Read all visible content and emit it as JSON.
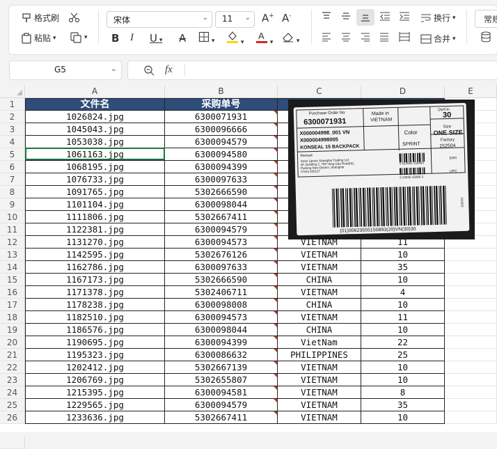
{
  "ribbon": {
    "format_painter": "格式刷",
    "paste": "粘贴",
    "font_name": "宋体",
    "font_size": "11",
    "wrap_text": "换行",
    "merge": "合并",
    "number_format": "常规"
  },
  "name_box": "G5",
  "formula_icon": "fx",
  "columns": [
    "A",
    "B",
    "C",
    "D",
    "E"
  ],
  "headers": {
    "a": "文件名",
    "b": "采购单号"
  },
  "rows": [
    {
      "n": "1"
    },
    {
      "n": "2",
      "a": "1026824.jpg",
      "b": "6300071931",
      "c": "",
      "d": ""
    },
    {
      "n": "3",
      "a": "1045043.jpg",
      "b": "6300096666",
      "c": "",
      "d": ""
    },
    {
      "n": "4",
      "a": "1053038.jpg",
      "b": "6300094579",
      "c": "",
      "d": ""
    },
    {
      "n": "5",
      "a": "1061163.jpg",
      "b": "6300094580",
      "c": "",
      "d": ""
    },
    {
      "n": "6",
      "a": "1068195.jpg",
      "b": "6300094399",
      "c": "",
      "d": ""
    },
    {
      "n": "7",
      "a": "1076733.jpg",
      "b": "6300097633",
      "c": "",
      "d": ""
    },
    {
      "n": "8",
      "a": "1091765.jpg",
      "b": "5302666590",
      "c": "",
      "d": ""
    },
    {
      "n": "9",
      "a": "1101104.jpg",
      "b": "6300098044",
      "c": "",
      "d": ""
    },
    {
      "n": "10",
      "a": "1111806.jpg",
      "b": "5302667411",
      "c": "",
      "d": ""
    },
    {
      "n": "11",
      "a": "1122381.jpg",
      "b": "6300094579",
      "c": "",
      "d": ""
    },
    {
      "n": "12",
      "a": "1131270.jpg",
      "b": "6300094573",
      "c": "VIETNAM",
      "d": "11"
    },
    {
      "n": "13",
      "a": "1142595.jpg",
      "b": "5302676126",
      "c": "VIETNAM",
      "d": "10"
    },
    {
      "n": "14",
      "a": "1162786.jpg",
      "b": "6300097633",
      "c": "VIETNAM",
      "d": "35"
    },
    {
      "n": "15",
      "a": "1167173.jpg",
      "b": "5302666590",
      "c": "CHINA",
      "d": "10"
    },
    {
      "n": "16",
      "a": "1171378.jpg",
      "b": "5302406711",
      "c": "VIETNAM",
      "d": "4"
    },
    {
      "n": "17",
      "a": "1178238.jpg",
      "b": "6300098008",
      "c": "CHINA",
      "d": "10"
    },
    {
      "n": "18",
      "a": "1182510.jpg",
      "b": "6300094573",
      "c": "VIETNAM",
      "d": "11"
    },
    {
      "n": "19",
      "a": "1186576.jpg",
      "b": "6300098044",
      "c": "CHINA",
      "d": "10"
    },
    {
      "n": "20",
      "a": "1190695.jpg",
      "b": "6300094399",
      "c": "VietNam",
      "d": "22"
    },
    {
      "n": "21",
      "a": "1195323.jpg",
      "b": "6300086632",
      "c": "PHILIPPINES",
      "d": "25"
    },
    {
      "n": "22",
      "a": "1202412.jpg",
      "b": "5302667139",
      "c": "VIETNAM",
      "d": "10"
    },
    {
      "n": "23",
      "a": "1206769.jpg",
      "b": "5302655807",
      "c": "VIETNAM",
      "d": "10"
    },
    {
      "n": "24",
      "a": "1215395.jpg",
      "b": "6300094581",
      "c": "VIETNAM",
      "d": "8"
    },
    {
      "n": "25",
      "a": "1229565.jpg",
      "b": "6300094579",
      "c": "VIETNAM",
      "d": "35"
    },
    {
      "n": "26",
      "a": "1233636.jpg",
      "b": "5302667411",
      "c": "VIETNAM",
      "d": "10"
    }
  ],
  "label": {
    "po_title": "Purchase Order No",
    "po_number": "6300071931",
    "made_in_title": "Made in",
    "made_in": "VIETNAM",
    "qty_title": "Qty/Ctn",
    "qty": "30",
    "size_title": "Size",
    "size": "ONE SIZE",
    "article_line": "X000004998_001    VN",
    "article_code": "X000004998005",
    "product": "KONSEAL 15 BACKPACK",
    "color_title": "Color",
    "color": "SPRINT",
    "factory_title": "Factory",
    "factory": "152504",
    "remark": "Remark",
    "address1": "Amer Sports Shanghai Trading Ltd.",
    "address2": "3F, Building 2, 799 Yang Gao Road(S),",
    "address3": "Pudong New District, Shanghai",
    "address4": "China 200127",
    "ean_number": "0 623555 150893",
    "ean": "EAN",
    "upc_number": "6  23555 15089  3",
    "upc": "UPC",
    "sscc": "(01)00623555150893(20)VN(30)30",
    "side_code": "118201"
  }
}
